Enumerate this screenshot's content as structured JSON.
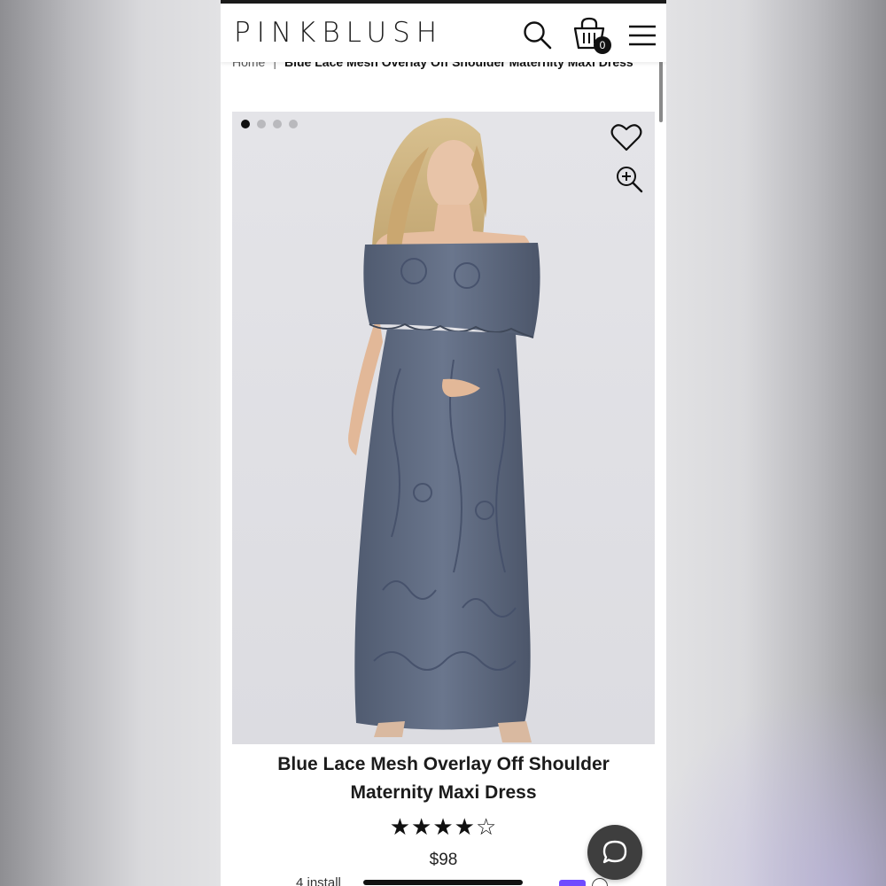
{
  "header": {
    "logo": "PINKBLUSH",
    "cart_count": "0",
    "icons": [
      "search-icon",
      "shopping-bag-icon",
      "menu-icon"
    ]
  },
  "breadcrumb": {
    "home": "Home",
    "separator": "|",
    "current": "Blue Lace Mesh Overlay Off Shoulder Maternity Maxi Dress"
  },
  "gallery": {
    "image_count": 4,
    "active_index": 0,
    "icons": [
      "heart-icon",
      "zoom-in-icon"
    ]
  },
  "product": {
    "title": "Blue Lace Mesh Overlay Off Shoulder Maternity Maxi Dress",
    "rating_stars": "★★★★☆",
    "rating": 4,
    "rating_max": 5,
    "price": "$98",
    "installment_text": "4 install"
  },
  "chat": {
    "icon": "chat-bubble-icon"
  },
  "colors": {
    "text": "#1b1b1b",
    "dress": "#5f6b82",
    "badge": "#111111",
    "afterpay": "#6f4bff",
    "chat_button": "#3e3e3e"
  }
}
